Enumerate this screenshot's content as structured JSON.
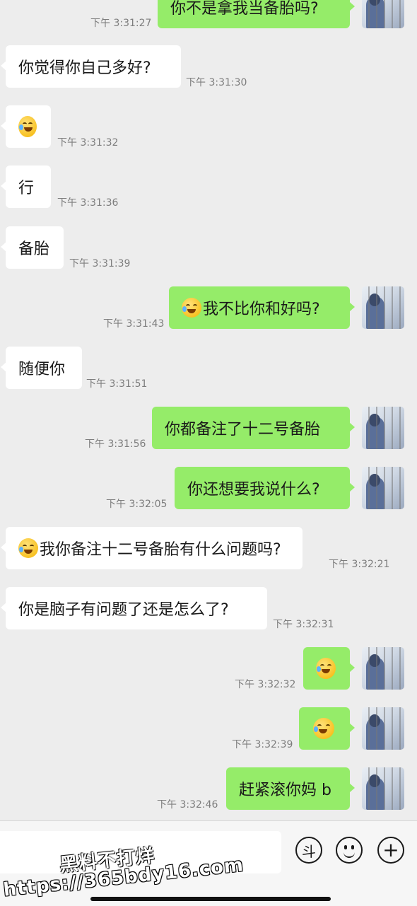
{
  "messages": [
    {
      "dir": "out",
      "text": "你不是拿我当备胎吗?",
      "time": "下午 3:31:27"
    },
    {
      "dir": "in",
      "text": "你觉得你自己多好?",
      "time": "下午 3:31:30"
    },
    {
      "dir": "in",
      "emoji": "face-with-tears-of-joy",
      "text": "",
      "time": "下午 3:31:32"
    },
    {
      "dir": "in",
      "text": "行",
      "time": "下午 3:31:36"
    },
    {
      "dir": "in",
      "text": "备胎",
      "time": "下午 3:31:39"
    },
    {
      "dir": "out",
      "emoji": "face-with-tears-of-joy",
      "text": "我不比你和好吗?",
      "time": "下午 3:31:43"
    },
    {
      "dir": "in",
      "text": "随便你",
      "time": "下午 3:31:51"
    },
    {
      "dir": "out",
      "text": "你都备注了十二号备胎",
      "time": "下午 3:31:56"
    },
    {
      "dir": "out",
      "text": "你还想要我说什么?",
      "time": "下午 3:32:05"
    },
    {
      "dir": "in",
      "emoji": "face-with-tears-of-joy",
      "text": "我你备注十二号备胎有什么问题吗?",
      "time": "下午 3:32:21"
    },
    {
      "dir": "in",
      "text": "你是脑子有问题了还是怎么了?",
      "time": "下午 3:32:31"
    },
    {
      "dir": "out",
      "emoji": "face-with-tears-of-joy",
      "text": "",
      "time": "下午 3:32:32"
    },
    {
      "dir": "out",
      "emoji": "face-with-tears-of-joy",
      "text": "",
      "time": "下午 3:32:39"
    },
    {
      "dir": "out",
      "text": "赶紧滚你妈 b",
      "time": "下午 3:32:46"
    }
  ],
  "input_bar": {
    "value": "",
    "dou_label": "斗",
    "emoji_icon": "smile-icon",
    "plus_label": "+"
  },
  "watermark": {
    "line1": "黑料不打烊",
    "line2": "https://365bdy16.com"
  },
  "colors": {
    "background": "#ededed",
    "outgoing_bubble": "#95ec69",
    "incoming_bubble": "#ffffff",
    "timestamp": "#7d7d7d"
  }
}
